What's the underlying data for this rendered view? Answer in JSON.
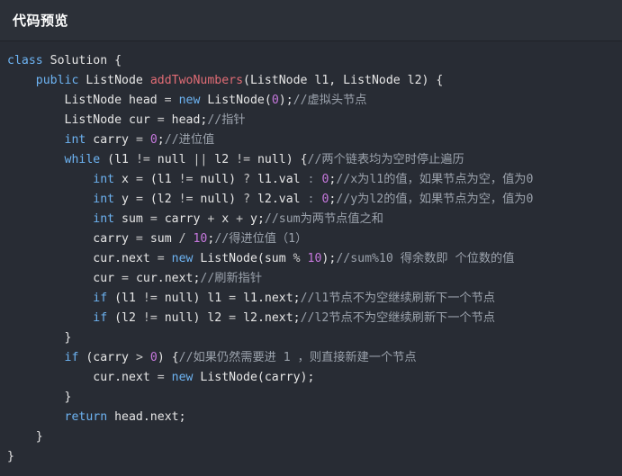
{
  "header": {
    "title": "代码预览"
  },
  "code_lines": [
    [
      {
        "t": "class",
        "c": "kw"
      },
      {
        "t": " Solution {",
        "c": "plain"
      }
    ],
    [
      {
        "t": "    ",
        "c": "plain"
      },
      {
        "t": "public",
        "c": "kw"
      },
      {
        "t": " ListNode ",
        "c": "plain"
      },
      {
        "t": "addTwoNumbers",
        "c": "fn"
      },
      {
        "t": "(ListNode l1, ListNode l2) {",
        "c": "plain"
      }
    ],
    [
      {
        "t": "        ListNode head ",
        "c": "plain"
      },
      {
        "t": "=",
        "c": "op"
      },
      {
        "t": " ",
        "c": "plain"
      },
      {
        "t": "new",
        "c": "kw"
      },
      {
        "t": " ListNode(",
        "c": "plain"
      },
      {
        "t": "0",
        "c": "num"
      },
      {
        "t": ");",
        "c": "plain"
      },
      {
        "t": "//虚拟头节点",
        "c": "cmt"
      }
    ],
    [
      {
        "t": "        ListNode cur ",
        "c": "plain"
      },
      {
        "t": "=",
        "c": "op"
      },
      {
        "t": " head;",
        "c": "plain"
      },
      {
        "t": "//指针",
        "c": "cmt"
      }
    ],
    [
      {
        "t": "        ",
        "c": "plain"
      },
      {
        "t": "int",
        "c": "kw"
      },
      {
        "t": " carry ",
        "c": "plain"
      },
      {
        "t": "=",
        "c": "op"
      },
      {
        "t": " ",
        "c": "plain"
      },
      {
        "t": "0",
        "c": "num"
      },
      {
        "t": ";",
        "c": "plain"
      },
      {
        "t": "//进位值",
        "c": "cmt"
      }
    ],
    [
      {
        "t": "        ",
        "c": "plain"
      },
      {
        "t": "while",
        "c": "kw"
      },
      {
        "t": " (l1 ",
        "c": "plain"
      },
      {
        "t": "!=",
        "c": "op"
      },
      {
        "t": " null ",
        "c": "plain"
      },
      {
        "t": "||",
        "c": "op"
      },
      {
        "t": " l2 ",
        "c": "plain"
      },
      {
        "t": "!=",
        "c": "op"
      },
      {
        "t": " null) {",
        "c": "plain"
      },
      {
        "t": "//两个链表均为空时停止遍历",
        "c": "cmt"
      }
    ],
    [
      {
        "t": "            ",
        "c": "plain"
      },
      {
        "t": "int",
        "c": "kw"
      },
      {
        "t": " x ",
        "c": "plain"
      },
      {
        "t": "=",
        "c": "op"
      },
      {
        "t": " (l1 ",
        "c": "plain"
      },
      {
        "t": "!=",
        "c": "op"
      },
      {
        "t": " null) ",
        "c": "plain"
      },
      {
        "t": "?",
        "c": "op"
      },
      {
        "t": " l1.val ",
        "c": "plain"
      },
      {
        "t": ":",
        "c": "grayop"
      },
      {
        "t": " ",
        "c": "plain"
      },
      {
        "t": "0",
        "c": "num"
      },
      {
        "t": ";",
        "c": "plain"
      },
      {
        "t": "//x为l1的值，如果节点为空，值为0",
        "c": "cmt"
      }
    ],
    [
      {
        "t": "            ",
        "c": "plain"
      },
      {
        "t": "int",
        "c": "kw"
      },
      {
        "t": " y ",
        "c": "plain"
      },
      {
        "t": "=",
        "c": "op"
      },
      {
        "t": " (l2 ",
        "c": "plain"
      },
      {
        "t": "!=",
        "c": "op"
      },
      {
        "t": " null) ",
        "c": "plain"
      },
      {
        "t": "?",
        "c": "op"
      },
      {
        "t": " l2.val ",
        "c": "plain"
      },
      {
        "t": ":",
        "c": "grayop"
      },
      {
        "t": " ",
        "c": "plain"
      },
      {
        "t": "0",
        "c": "num"
      },
      {
        "t": ";",
        "c": "plain"
      },
      {
        "t": "//y为l2的值，如果节点为空，值为0",
        "c": "cmt"
      }
    ],
    [
      {
        "t": "            ",
        "c": "plain"
      },
      {
        "t": "int",
        "c": "kw"
      },
      {
        "t": " sum ",
        "c": "plain"
      },
      {
        "t": "=",
        "c": "op"
      },
      {
        "t": " carry ",
        "c": "plain"
      },
      {
        "t": "+",
        "c": "op"
      },
      {
        "t": " x ",
        "c": "plain"
      },
      {
        "t": "+",
        "c": "op"
      },
      {
        "t": " y;",
        "c": "plain"
      },
      {
        "t": "//sum为两节点值之和",
        "c": "cmt"
      }
    ],
    [
      {
        "t": "            carry ",
        "c": "plain"
      },
      {
        "t": "=",
        "c": "op"
      },
      {
        "t": " sum ",
        "c": "plain"
      },
      {
        "t": "/",
        "c": "op"
      },
      {
        "t": " ",
        "c": "plain"
      },
      {
        "t": "10",
        "c": "num"
      },
      {
        "t": ";",
        "c": "plain"
      },
      {
        "t": "//得进位值（1）",
        "c": "cmt"
      }
    ],
    [
      {
        "t": "            cur.next ",
        "c": "plain"
      },
      {
        "t": "=",
        "c": "op"
      },
      {
        "t": " ",
        "c": "plain"
      },
      {
        "t": "new",
        "c": "kw"
      },
      {
        "t": " ListNode(sum ",
        "c": "plain"
      },
      {
        "t": "%",
        "c": "op"
      },
      {
        "t": " ",
        "c": "plain"
      },
      {
        "t": "10",
        "c": "num"
      },
      {
        "t": ");",
        "c": "plain"
      },
      {
        "t": "//sum%10 得余数即 个位数的值",
        "c": "cmt"
      }
    ],
    [
      {
        "t": "            cur ",
        "c": "plain"
      },
      {
        "t": "=",
        "c": "op"
      },
      {
        "t": " cur.next;",
        "c": "plain"
      },
      {
        "t": "//刷新指针",
        "c": "cmt"
      }
    ],
    [
      {
        "t": "            ",
        "c": "plain"
      },
      {
        "t": "if",
        "c": "kw"
      },
      {
        "t": " (l1 ",
        "c": "plain"
      },
      {
        "t": "!=",
        "c": "op"
      },
      {
        "t": " null) l1 ",
        "c": "plain"
      },
      {
        "t": "=",
        "c": "op"
      },
      {
        "t": " l1.next;",
        "c": "plain"
      },
      {
        "t": "//l1节点不为空继续刷新下一个节点",
        "c": "cmt"
      }
    ],
    [
      {
        "t": "            ",
        "c": "plain"
      },
      {
        "t": "if",
        "c": "kw"
      },
      {
        "t": " (l2 ",
        "c": "plain"
      },
      {
        "t": "!=",
        "c": "op"
      },
      {
        "t": " null) l2 ",
        "c": "plain"
      },
      {
        "t": "=",
        "c": "op"
      },
      {
        "t": " l2.next;",
        "c": "plain"
      },
      {
        "t": "//l2节点不为空继续刷新下一个节点",
        "c": "cmt"
      }
    ],
    [
      {
        "t": "        }",
        "c": "plain"
      }
    ],
    [
      {
        "t": "        ",
        "c": "plain"
      },
      {
        "t": "if",
        "c": "kw"
      },
      {
        "t": " (carry ",
        "c": "plain"
      },
      {
        "t": ">",
        "c": "op"
      },
      {
        "t": " ",
        "c": "plain"
      },
      {
        "t": "0",
        "c": "num"
      },
      {
        "t": ") {",
        "c": "plain"
      },
      {
        "t": "//如果仍然需要进 1 ，则直接新建一个节点",
        "c": "cmt"
      }
    ],
    [
      {
        "t": "            cur.next ",
        "c": "plain"
      },
      {
        "t": "=",
        "c": "op"
      },
      {
        "t": " ",
        "c": "plain"
      },
      {
        "t": "new",
        "c": "kw"
      },
      {
        "t": " ListNode(carry);",
        "c": "plain"
      }
    ],
    [
      {
        "t": "        }",
        "c": "plain"
      }
    ],
    [
      {
        "t": "        ",
        "c": "plain"
      },
      {
        "t": "return",
        "c": "kw"
      },
      {
        "t": " head.next;",
        "c": "plain"
      }
    ],
    [
      {
        "t": "    }",
        "c": "plain"
      }
    ],
    [
      {
        "t": "}",
        "c": "plain"
      }
    ]
  ]
}
